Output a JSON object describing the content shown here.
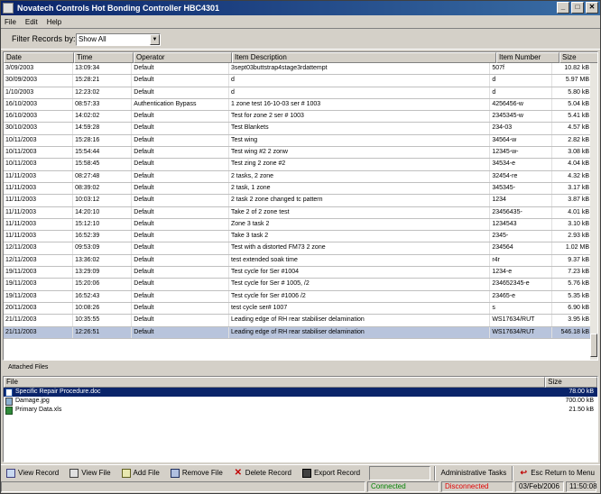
{
  "window": {
    "title": "Novatech Controls Hot Bonding Controller HBC4301"
  },
  "menu": [
    "File",
    "Edit",
    "Help"
  ],
  "filter": {
    "label": "Filter Records by:",
    "value": "Show All"
  },
  "grid": {
    "columns": [
      "Date",
      "Time",
      "Operator",
      "Item Description",
      "Item Number",
      "Size"
    ],
    "rows": [
      [
        "3/09/2003",
        "13:09:34",
        "Default",
        "3sept03buttstrap4stage3rdattempt",
        "507f",
        "10.82 kB"
      ],
      [
        "30/09/2003",
        "15:28:21",
        "Default",
        "d",
        "d",
        "5.97 MB"
      ],
      [
        "1/10/2003",
        "12:23:02",
        "Default",
        "d",
        "d",
        "5.80 kB"
      ],
      [
        "16/10/2003",
        "08:57:33",
        "Authentication Bypass",
        "1 zone test 16-10-03 ser # 1003",
        "4256456-w",
        "5.04 kB"
      ],
      [
        "16/10/2003",
        "14:02:02",
        "Default",
        "Test for zone 2 ser # 1003",
        "2345345-w",
        "5.41 kB"
      ],
      [
        "30/10/2003",
        "14:59:28",
        "Default",
        "Test Blankets",
        "234-03",
        "4.57 kB"
      ],
      [
        "10/11/2003",
        "15:28:16",
        "Default",
        "Test wing",
        "34564-w",
        "2.82 kB"
      ],
      [
        "10/11/2003",
        "15:54:44",
        "Default",
        "Test wing #2 2 zonw",
        "12345-w-",
        "3.08 kB"
      ],
      [
        "10/11/2003",
        "15:58:45",
        "Default",
        "Test zing 2 zone #2",
        "34534-e",
        "4.04 kB"
      ],
      [
        "11/11/2003",
        "08:27:48",
        "Default",
        "2 tasks, 2 zone",
        "32454-re",
        "4.32 kB"
      ],
      [
        "11/11/2003",
        "08:39:02",
        "Default",
        "2 task, 1 zone",
        "345345-",
        "3.17 kB"
      ],
      [
        "11/11/2003",
        "10:03:12",
        "Default",
        "2 task 2 zone changed tc pattern",
        "1234",
        "3.87 kB"
      ],
      [
        "11/11/2003",
        "14:20:10",
        "Default",
        "Take 2 of 2 zone test",
        "23456435-",
        "4.01 kB"
      ],
      [
        "11/11/2003",
        "15:12:10",
        "Default",
        "Zone 3 task 2",
        "1234543",
        "3.10 kB"
      ],
      [
        "11/11/2003",
        "16:52:39",
        "Default",
        "Take 3 task 2",
        "2345-",
        "2.93 kB"
      ],
      [
        "12/11/2003",
        "09:53:09",
        "Default",
        "Test with a distorted FM73 2 zone",
        "234564",
        "1.02 MB"
      ],
      [
        "12/11/2003",
        "13:36:02",
        "Default",
        "test extended soak time",
        "r4r",
        "9.37 kB"
      ],
      [
        "19/11/2003",
        "13:29:09",
        "Default",
        "Test cycle for Ser #1004",
        "1234-e",
        "7.23 kB"
      ],
      [
        "19/11/2003",
        "15:20:06",
        "Default",
        "Test cycle for Ser # 1005, /2",
        "234652345-e",
        "5.76 kB"
      ],
      [
        "19/11/2003",
        "16:52:43",
        "Default",
        "Test cycle for Ser #1006 /2",
        "23465-e",
        "5.35 kB"
      ],
      [
        "20/11/2003",
        "10:08:26",
        "Default",
        "test cycle ser# 1007",
        "s",
        "6.90 kB"
      ],
      [
        "21/11/2003",
        "10:35:55",
        "Default",
        "Leading edge of RH rear stabiliser delamination",
        "WS17634/RUT",
        "3.95 kB"
      ],
      [
        "21/11/2003",
        "12:26:51",
        "Default",
        "Leading edge of RH rear stabiliser delamination",
        "WS17634/RUT",
        "546.18 kB"
      ]
    ],
    "selected_index": 22
  },
  "attached": {
    "label": "Attached Files",
    "columns": [
      "File",
      "Size"
    ],
    "files": [
      {
        "name": "Specific Repair Procedure.doc",
        "size": "78.00 kB",
        "icon": "doc-file-icon",
        "type": "doc"
      },
      {
        "name": "Damage.jpg",
        "size": "700.00 kB",
        "icon": "image-file-icon",
        "type": "jpg"
      },
      {
        "name": "Primary Data.xls",
        "size": "21.50 kB",
        "icon": "spreadsheet-file-icon",
        "type": "xls"
      }
    ],
    "selected_index": 0
  },
  "toolbar": {
    "view_record": "View Record",
    "view_file": "View File",
    "add_file": "Add File",
    "remove_file": "Remove File",
    "delete_record": "Delete Record",
    "export_record": "Export Record",
    "admin_tasks": "Administrative Tasks",
    "esc_return": "Esc Return to Menu"
  },
  "status": {
    "connected": "Connected",
    "disconnected": "Disconnected",
    "date": "03/Feb/2006",
    "time": "11:50:08"
  },
  "colors": {
    "title_bar": "#0a246a",
    "selected_row": "#b8c4dc",
    "selected_file": "#0a246a",
    "connected": "#008000",
    "disconnected": "#e00000"
  }
}
